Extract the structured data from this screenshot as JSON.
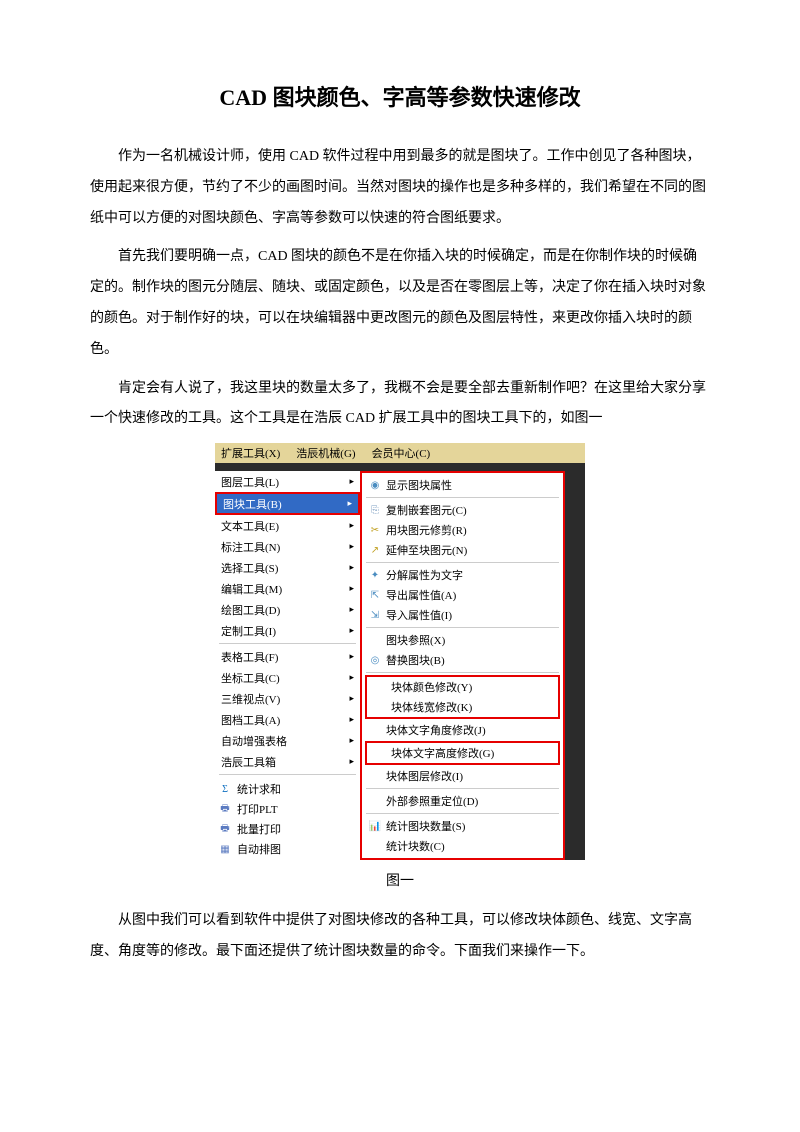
{
  "title": "CAD 图块颜色、字高等参数快速修改",
  "para1": "作为一名机械设计师，使用 CAD 软件过程中用到最多的就是图块了。工作中创见了各种图块，使用起来很方便，节约了不少的画图时间。当然对图块的操作也是多种多样的，我们希望在不同的图纸中可以方便的对图块颜色、字高等参数可以快速的符合图纸要求。",
  "para2": "首先我们要明确一点，CAD 图块的颜色不是在你插入块的时候确定，而是在你制作块的时候确定的。制作块的图元分随层、随块、或固定颜色，以及是否在零图层上等，决定了你在插入块时对象的颜色。对于制作好的块，可以在块编辑器中更改图元的颜色及图层特性，来更改你插入块时的颜色。",
  "para3": "肯定会有人说了，我这里块的数量太多了，我概不会是要全部去重新制作吧？在这里给大家分享一个快速修改的工具。这个工具是在浩辰 CAD 扩展工具中的图块工具下的，如图一",
  "figure_caption": "图一",
  "para4": "从图中我们可以看到软件中提供了对图块修改的各种工具，可以修改块体颜色、线宽、文字高度、角度等的修改。最下面还提供了统计图块数量的命令。下面我们来操作一下。",
  "menubar": {
    "item1": "扩展工具(X)",
    "item2": "浩辰机械(G)",
    "item3": "会员中心(C)"
  },
  "left_menu": {
    "layer": "图层工具(L)",
    "block": "图块工具(B)",
    "text": "文本工具(E)",
    "dim": "标注工具(N)",
    "select": "选择工具(S)",
    "edit": "编辑工具(M)",
    "draw": "绘图工具(D)",
    "custom": "定制工具(I)",
    "table": "表格工具(F)",
    "coord": "坐标工具(C)",
    "view3d": "三维视点(V)",
    "docinfo": "图档工具(A)",
    "autotable": "自动增强表格",
    "toolbox": "浩辰工具箱",
    "sum": "统计求和",
    "plt": "打印PLT",
    "batch": "批量打印",
    "auto": "自动排图"
  },
  "right_menu": {
    "show_attr": "显示图块属性",
    "copy_nest": "复制嵌套图元(C)",
    "trim_block": "用块图元修剪(R)",
    "extend_block": "延伸至块图元(N)",
    "explode_text": "分解属性为文字",
    "export_attr": "导出属性值(A)",
    "import_attr": "导入属性值(I)",
    "block_ref": "图块参照(X)",
    "replace_block": "替换图块(B)",
    "color_mod": "块体颜色修改(Y)",
    "linewidth_mod": "块体线宽修改(K)",
    "text_angle": "块体文字角度修改(J)",
    "text_height": "块体文字高度修改(G)",
    "layer_mod": "块体图层修改(I)",
    "xref_reloc": "外部参照重定位(D)",
    "count_block_s": "统计图块数量(S)",
    "count_block_c": "统计块数(C)"
  }
}
